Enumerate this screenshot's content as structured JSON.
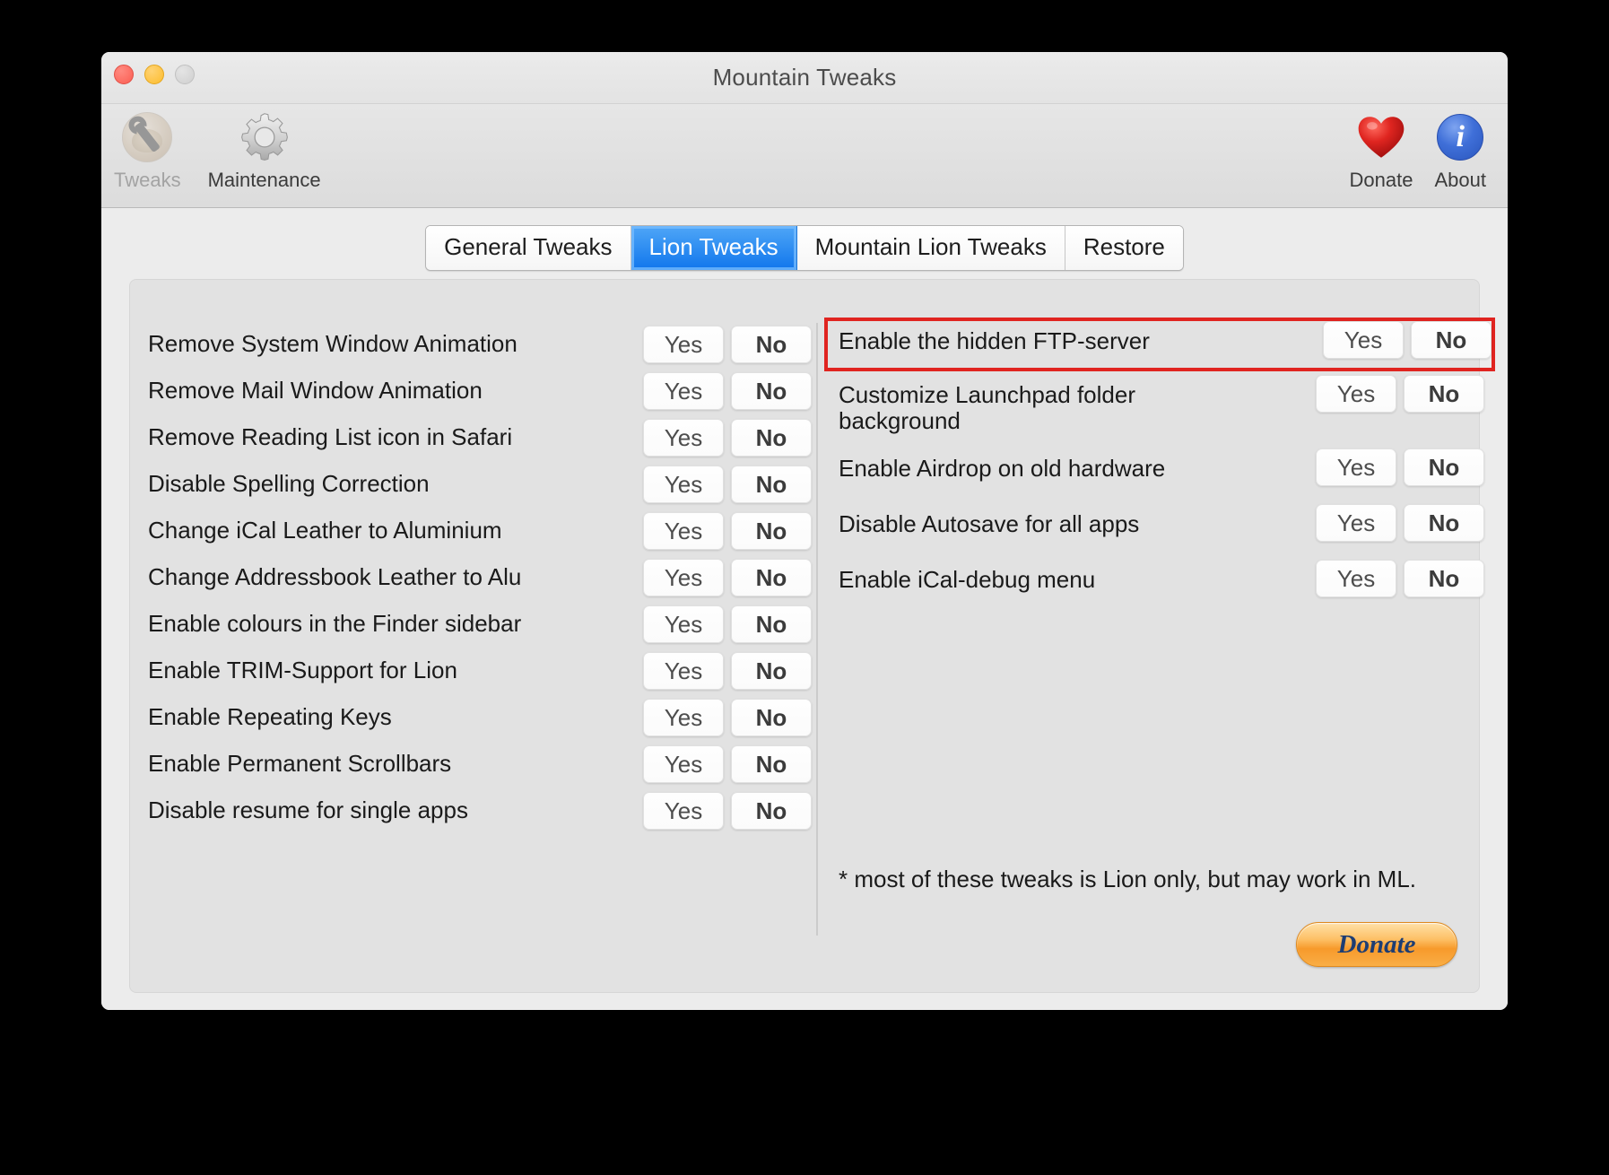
{
  "window": {
    "title": "Mountain Tweaks",
    "traffic_lights": [
      "close",
      "minimize",
      "zoom"
    ]
  },
  "toolbar": {
    "left_items": [
      {
        "label": "Tweaks",
        "icon": "tweaks-icon",
        "selected": true
      },
      {
        "label": "Maintenance",
        "icon": "gear-icon",
        "selected": false
      }
    ],
    "right_items": [
      {
        "label": "Donate",
        "icon": "heart-icon"
      },
      {
        "label": "About",
        "icon": "info-icon",
        "glyph": "i"
      }
    ]
  },
  "tabs": [
    {
      "label": "General Tweaks",
      "active": false
    },
    {
      "label": "Lion Tweaks",
      "active": true
    },
    {
      "label": "Mountain Lion Tweaks",
      "active": false
    },
    {
      "label": "Restore",
      "active": false
    }
  ],
  "buttons": {
    "yes": "Yes",
    "no": "No"
  },
  "left_column": [
    {
      "label": "Remove System Window Animation"
    },
    {
      "label": "Remove Mail Window Animation"
    },
    {
      "label": "Remove Reading List icon in Safari"
    },
    {
      "label": "Disable Spelling Correction"
    },
    {
      "label": "Change iCal Leather to Aluminium"
    },
    {
      "label": "Change Addressbook Leather to Alu"
    },
    {
      "label": "Enable colours in the Finder sidebar"
    },
    {
      "label": "Enable TRIM-Support for Lion"
    },
    {
      "label": "Enable Repeating Keys"
    },
    {
      "label": "Enable Permanent Scrollbars"
    },
    {
      "label": "Disable resume for single apps"
    }
  ],
  "right_column": [
    {
      "label": "Enable the hidden FTP-server",
      "highlighted": true
    },
    {
      "label": "Customize Launchpad folder background",
      "highlighted": false
    },
    {
      "label": "Enable Airdrop on old hardware",
      "highlighted": false
    },
    {
      "label": "Disable Autosave for all apps",
      "highlighted": false
    },
    {
      "label": "Enable iCal-debug menu",
      "highlighted": false
    }
  ],
  "footnote": "* most of these tweaks is Lion only, but may work in ML.",
  "donate_button": {
    "label": "Donate"
  },
  "colors": {
    "accent_tab": "#1076ec",
    "highlight_outline": "#e02420",
    "window_bg": "#ececec",
    "panel_bg": "#e2e2e2",
    "donate_orange": "#f79a2b",
    "donate_text": "#1d3d73",
    "about_blue": "#2a56bd",
    "heart_red": "#cc1b1b"
  }
}
